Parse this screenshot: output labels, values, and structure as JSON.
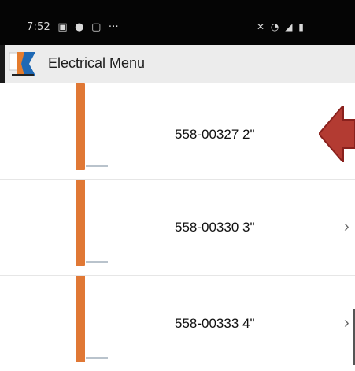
{
  "status_bar": {
    "time": "7:52",
    "left_icons": [
      "gallery-icon",
      "security-icon",
      "screenshot-icon"
    ],
    "overflow": "···",
    "right_icons": [
      "mute-icon",
      "wifi-icon",
      "signal-icon",
      "battery-icon"
    ]
  },
  "toolbar": {
    "title": "Electrical Menu",
    "logo_colors": {
      "orange": "#e57c2d",
      "blue": "#1f69b5",
      "dark": "#111111"
    }
  },
  "items": [
    {
      "label": "558-00327 2\"",
      "selected": true
    },
    {
      "label": "558-00330 3\"",
      "chevron": "›"
    },
    {
      "label": "558-00333 4\"",
      "chevron": "›"
    }
  ],
  "colors": {
    "pipe": "#e07835",
    "arrow": "#b33b32"
  }
}
